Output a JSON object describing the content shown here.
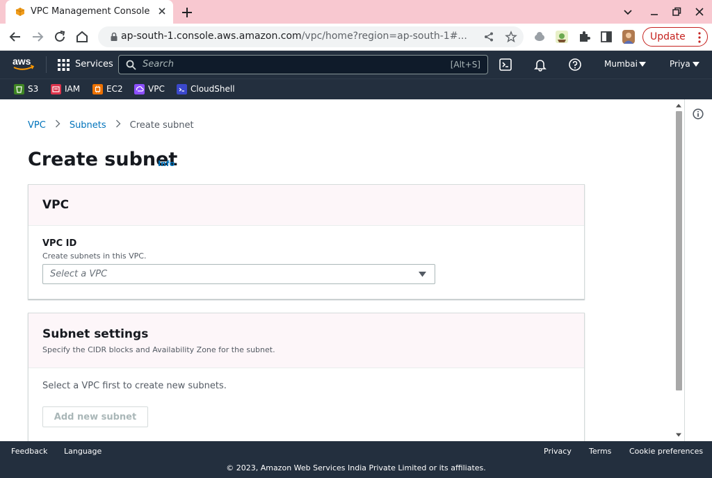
{
  "browser": {
    "tab_title": "VPC Management Console",
    "url_main": "ap-south-1.console.aws.amazon.com",
    "url_rest": "/vpc/home?region=ap-south-1#...",
    "update_label": "Update"
  },
  "aws_nav": {
    "services_label": "Services",
    "search_placeholder": "Search",
    "search_shortcut": "[Alt+S]",
    "region": "Mumbai",
    "user": "Priya"
  },
  "favorites": [
    {
      "label": "S3",
      "color": "#3f8624"
    },
    {
      "label": "IAM",
      "color": "#dd344c"
    },
    {
      "label": "EC2",
      "color": "#ed7100"
    },
    {
      "label": "VPC",
      "color": "#8c4fff"
    },
    {
      "label": "CloudShell",
      "color": "#3b48cc"
    }
  ],
  "breadcrumb": {
    "items": [
      "VPC",
      "Subnets"
    ],
    "current": "Create subnet"
  },
  "page": {
    "title": "Create subnet",
    "info": "Info"
  },
  "vpc_panel": {
    "title": "VPC",
    "field_label": "VPC ID",
    "field_desc": "Create subnets in this VPC.",
    "select_placeholder": "Select a VPC"
  },
  "subnet_panel": {
    "title": "Subnet settings",
    "desc": "Specify the CIDR blocks and Availability Zone for the subnet.",
    "empty_message": "Select a VPC first to create new subnets.",
    "add_button": "Add new subnet"
  },
  "footer": {
    "feedback": "Feedback",
    "language": "Language",
    "privacy": "Privacy",
    "terms": "Terms",
    "cookies": "Cookie preferences",
    "copyright": "© 2023, Amazon Web Services India Private Limited or its affiliates."
  },
  "colors": {
    "link": "#0073bb",
    "aws_dark": "#232f3e",
    "tab_strip": "#f8c8d0",
    "update": "#c5221f"
  }
}
